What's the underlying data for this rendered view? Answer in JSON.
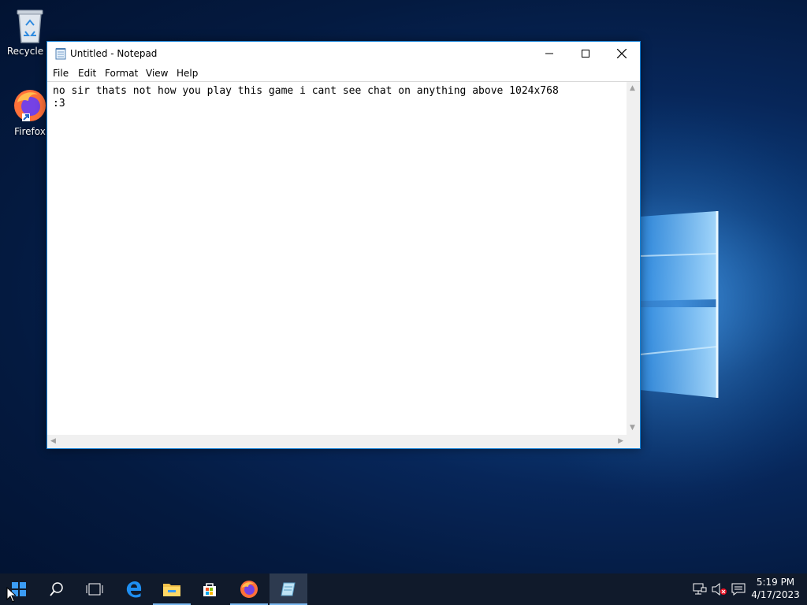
{
  "desktop": {
    "icons": [
      {
        "label": "Recycle B"
      },
      {
        "label": "Firefox"
      }
    ]
  },
  "notepad": {
    "title": "Untitled - Notepad",
    "menu": [
      "File",
      "Edit",
      "Format",
      "View",
      "Help"
    ],
    "content": "no sir thats not how you play this game i cant see chat on anything above 1024x768\n:3"
  },
  "taskbar": {
    "items": [
      "start-icon",
      "search-icon",
      "task-view-icon",
      "edge-icon",
      "file-explorer-icon",
      "store-icon",
      "firefox-icon",
      "notepad-icon"
    ],
    "clock_time": "5:19 PM",
    "clock_date": "4/17/2023"
  },
  "colors": {
    "accent": "#1883d7",
    "taskbar": "#101a2b",
    "wallpaper": "#072659"
  }
}
